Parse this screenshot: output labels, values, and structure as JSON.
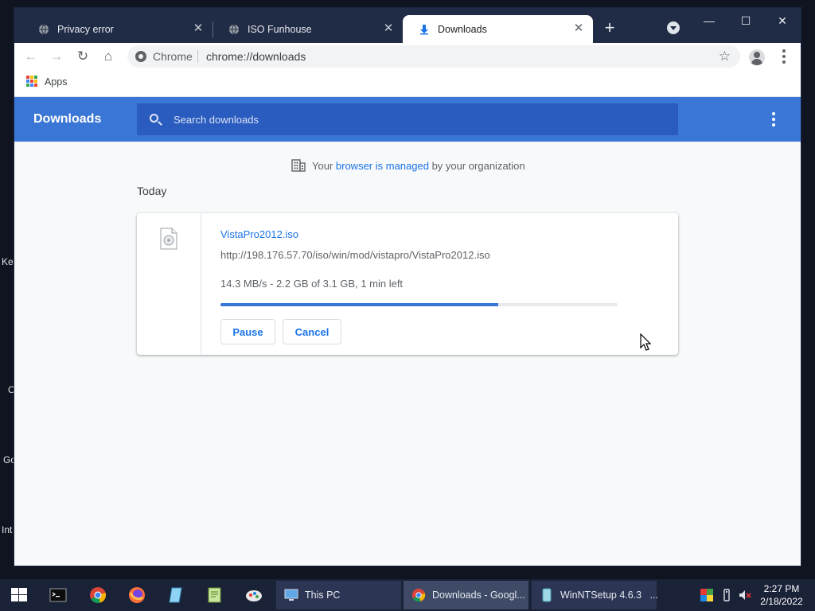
{
  "desktop": {
    "fragments": [
      "Key",
      "C",
      "Go",
      "Int"
    ]
  },
  "browser": {
    "tabs": [
      {
        "title": "Privacy error",
        "close": "✕",
        "active": false
      },
      {
        "title": "ISO Funhouse",
        "close": "✕",
        "active": false
      },
      {
        "title": "Downloads",
        "close": "✕",
        "active": true
      }
    ],
    "new_tab_glyph": "+",
    "window_controls": {
      "minimize": "—",
      "maximize": "☐",
      "close": "✕"
    },
    "nav": {
      "back": "←",
      "forward": "→",
      "reload": "↻",
      "home": "⌂"
    },
    "omnibox": {
      "chip_label": "Chrome",
      "url": "chrome://downloads",
      "star": "☆"
    },
    "bookmarks": {
      "apps_label": "Apps"
    }
  },
  "downloads_page": {
    "title": "Downloads",
    "search_placeholder": "Search downloads",
    "managed_notice": {
      "prefix": "Your ",
      "link": "browser is managed",
      "suffix": " by your organization"
    },
    "section_label": "Today",
    "items": [
      {
        "file_name": "VistaPro2012.iso",
        "url": "http://198.176.57.70/iso/win/mod/vistapro/VistaPro2012.iso",
        "status": "14.3 MB/s - 2.2 GB of 3.1 GB, 1 min left",
        "progress_fraction": 0.7,
        "pause_label": "Pause",
        "cancel_label": "Cancel"
      }
    ]
  },
  "taskbar": {
    "tasks": [
      {
        "label": "This PC",
        "active": false
      },
      {
        "label": "Downloads - Googl...",
        "active": true
      },
      {
        "label": "WinNTSetup 4.6.3   ...",
        "active": false
      }
    ],
    "clock": {
      "time": "2:27 PM",
      "date": "2/18/2022"
    }
  },
  "colors": {
    "accent_blue": "#3a76d6",
    "link_blue": "#1a73e8",
    "tab_strip": "#202b46",
    "taskbar": "#1a2238"
  }
}
